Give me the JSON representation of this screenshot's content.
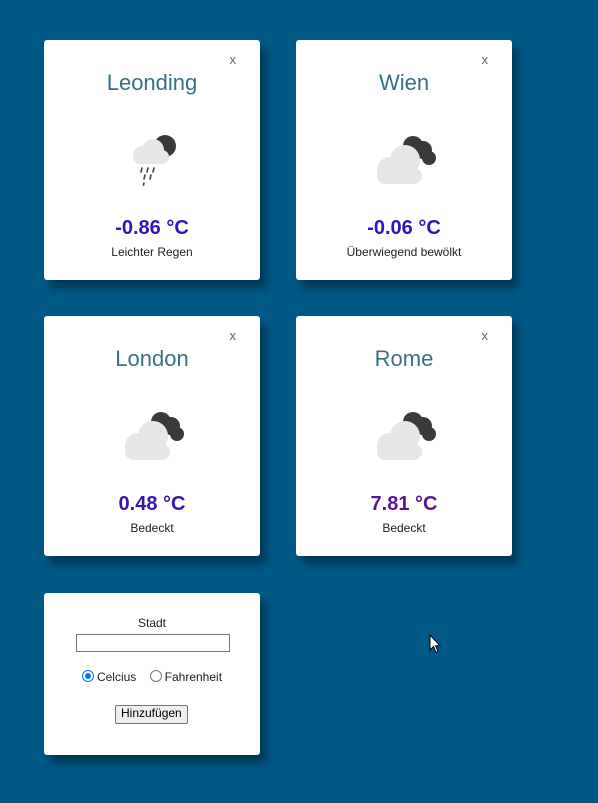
{
  "cards": [
    {
      "city": "Leonding",
      "close": "x",
      "temp": "-0.86 °C",
      "desc": "Leichter Regen",
      "icon": "rain-night-icon",
      "temp_color": "#3314b8"
    },
    {
      "city": "Wien",
      "close": "x",
      "temp": "-0.06 °C",
      "desc": "Überwiegend bewölkt",
      "icon": "cloudy-night-icon",
      "temp_color": "#3314b8"
    },
    {
      "city": "London",
      "close": "x",
      "temp": "0.48 °C",
      "desc": "Bedeckt",
      "icon": "cloudy-night-icon",
      "temp_color": "#3b14b0"
    },
    {
      "city": "Rome",
      "close": "x",
      "temp": "7.81 °C",
      "desc": "Bedeckt",
      "icon": "cloudy-night-icon",
      "temp_color": "#5a1497"
    }
  ],
  "form": {
    "city_label": "Stadt",
    "city_value": "",
    "unit_celsius": "Celcius",
    "unit_fahrenheit": "Fahrenheit",
    "selected_unit": "Celcius",
    "add_button": "Hinzufügen"
  },
  "colors": {
    "background": "#005885",
    "card": "#ffffff",
    "city_text": "#3a6f8a"
  }
}
